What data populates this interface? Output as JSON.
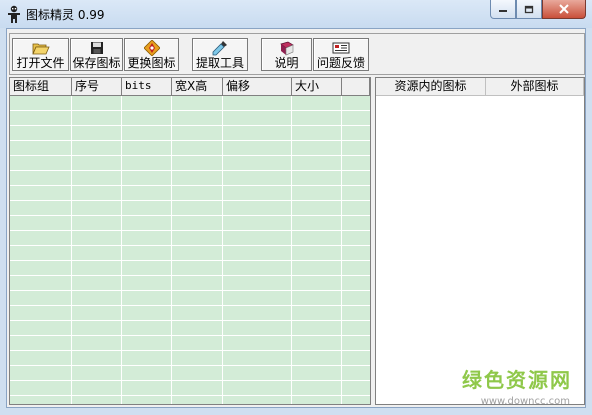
{
  "window": {
    "title": "图标精灵 0.99"
  },
  "title_buttons": {
    "minimize": "▁",
    "maximize": "□",
    "close": "X"
  },
  "toolbar": [
    {
      "name": "open-file-button",
      "icon": "folder-open-icon",
      "label": "打开文件"
    },
    {
      "name": "save-icon-button",
      "icon": "floppy-disk-icon",
      "label": "保存图标"
    },
    {
      "name": "replace-icon-button",
      "icon": "replace-arrows-icon",
      "label": "更换图标"
    },
    {
      "name": "extract-tool-button",
      "icon": "eyedropper-icon",
      "label": "提取工具"
    },
    {
      "name": "help-button",
      "icon": "book-icon",
      "label": "说明"
    },
    {
      "name": "feedback-button",
      "icon": "feedback-card-icon",
      "label": "问题反馈"
    }
  ],
  "icon_table": {
    "columns": [
      "图标组",
      "序号",
      "bits",
      "宽X高",
      "偏移",
      "大小",
      ""
    ]
  },
  "resource_list": {
    "columns": [
      "资源内的图标",
      "外部图标"
    ]
  },
  "watermark": {
    "text": "绿色资源网",
    "url": "www.downcc.com"
  }
}
